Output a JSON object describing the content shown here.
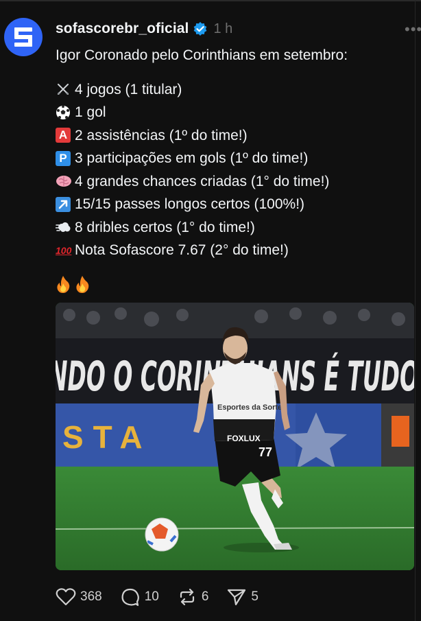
{
  "post": {
    "username": "sofascorebr_oficial",
    "time": "1 h",
    "more": "•••",
    "headline": "Igor Coronado pelo Corinthians em setembro:",
    "stats": [
      {
        "icon": "crossed-swords-icon",
        "text": "4 jogos (1 titular)"
      },
      {
        "icon": "soccer-ball-icon",
        "text": "1 gol"
      },
      {
        "icon": "a-button-icon",
        "text": "2 assistências (1º do time!)"
      },
      {
        "icon": "p-button-icon",
        "text": "3 participações em gols (1º do time!)"
      },
      {
        "icon": "brain-icon",
        "text": "4 grandes chances criadas (1° do time!)"
      },
      {
        "icon": "up-right-arrow-icon",
        "text": "15/15 passes longos certos (100%!)"
      },
      {
        "icon": "dash-cloud-icon",
        "text": "8 dribles certos (1° do time!)"
      },
      {
        "icon": "hundred-points-icon",
        "text": "Nota Sofascore 7.67 (2° do time!)"
      }
    ],
    "emoji_labels": {
      "a": "A",
      "p": "P",
      "hundred": "100"
    },
    "photo": {
      "banner_text": "NDO O CORINTHIANS É TUDO",
      "ad_text": "STA",
      "sponsor": "Esportes da Sorte",
      "kit_sponsor": "FOXLUX",
      "shorts_number": "77"
    },
    "actions": {
      "likes": "368",
      "replies": "10",
      "reposts": "6",
      "shares": "5"
    },
    "colors": {
      "background": "#101010",
      "avatar": "#2f64f6",
      "verified": "#1d9bf0",
      "muted": "#6f6f6f"
    }
  }
}
